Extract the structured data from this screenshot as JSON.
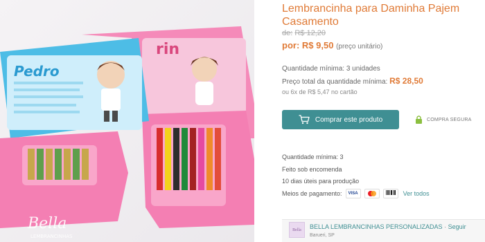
{
  "product": {
    "title": "Lembrancinha para Daminha Pajem Casamento",
    "old_price_prefix": "de:",
    "old_price": "R$ 12,20",
    "price_prefix": "por:",
    "price": "R$ 9,50",
    "price_unit": "(preço unitário)"
  },
  "quantity": {
    "min_label": "Quantidade mínima: 3 unidades",
    "total_label": "Preço total da quantidade mínima:",
    "total_value": "R$ 28,50",
    "installments": "ou 6x de R$ 5,47 no cartão"
  },
  "actions": {
    "buy_label": "Comprar este produto",
    "secure_label": "COMPRA SEGURA"
  },
  "details": {
    "min_qty": "Quantidade mínima: 3",
    "made_to_order": "Feito sob encomenda",
    "production_time": "10 dias úteis para produção",
    "payment_label": "Meios de pagamento:",
    "payment_methods": [
      "VISA",
      "mastercard",
      "BOLETO"
    ],
    "see_all": "Ver todos"
  },
  "store": {
    "name": "BELLA LEMBRANCINHAS PERSONALIZADAS",
    "separator": "·",
    "follow": "Seguir",
    "location": "Barueri, SP",
    "logo_text": "Bella"
  },
  "image": {
    "card_boy_name": "Pedro",
    "card_girl_name": "rin",
    "watermark": "Bella",
    "watermark_sub": "LEMBRANCINHAS"
  },
  "colors": {
    "accent_orange": "#e07a36",
    "teal": "#3f8f93",
    "box_pink": "#f06fa8",
    "box_blue": "#52c0e6"
  },
  "icons": [
    "cart-icon",
    "lock-icon",
    "visa-icon",
    "mastercard-icon",
    "boleto-icon"
  ]
}
